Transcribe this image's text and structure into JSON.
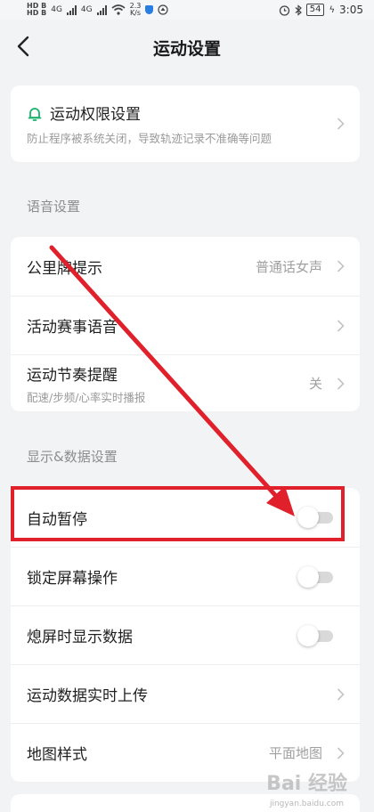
{
  "status_bar": {
    "hd1": "HD B",
    "hd2": "HD B",
    "net1": "4G",
    "net2": "4G",
    "speed_value": "2.3",
    "speed_unit": "K/s",
    "battery": "54",
    "time": "3:05"
  },
  "header": {
    "title": "运动设置"
  },
  "permission_card": {
    "title": "运动权限设置",
    "subtitle": "防止程序被系统关闭，导致轨迹记录不准确等问题",
    "icon": "bell-icon",
    "accent": "#19b36b"
  },
  "voice_section": {
    "title": "语音设置",
    "items": [
      {
        "label": "公里牌提示",
        "value": "普通话女声"
      },
      {
        "label": "活动赛事语音",
        "value": ""
      },
      {
        "label": "运动节奏提醒",
        "subtitle": "配速/步频/心率实时播报",
        "value": "关"
      }
    ]
  },
  "display_section": {
    "title": "显示&数据设置",
    "items": [
      {
        "label": "自动暂停",
        "toggle": false
      },
      {
        "label": "锁定屏幕操作",
        "toggle": false
      },
      {
        "label": "熄屏时显示数据",
        "toggle": false
      },
      {
        "label": "运动数据实时上传",
        "value": ""
      },
      {
        "label": "地图样式",
        "value": "平面地图"
      }
    ]
  },
  "annotation": {
    "color": "#e0202a"
  },
  "watermark": {
    "text": "Bai 经验",
    "sub": "jingyan.baidu.com"
  }
}
